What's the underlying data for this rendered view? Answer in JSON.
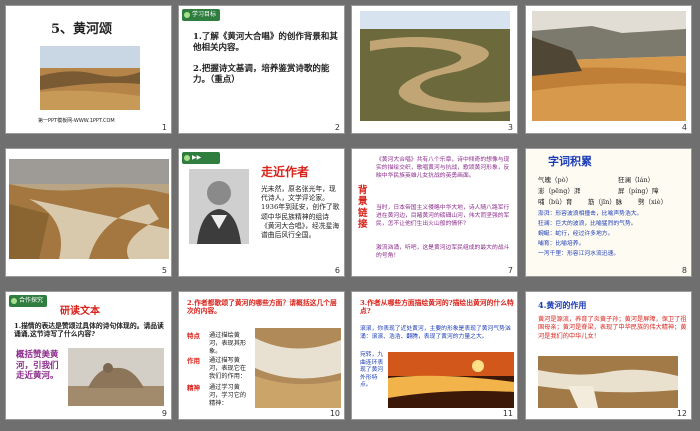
{
  "s1": {
    "title": "5、黄河颂",
    "footer": "第一PPT模板网-WWW.1PPT.COM",
    "num": "1"
  },
  "s2": {
    "tag": "学习目标",
    "goal1": "1.了解《黄河大合唱》的创作背景和其他相关内容。",
    "goal2": "2.把握诗文基调，培养鉴赏诗歌的能力。（重点）",
    "num": "2"
  },
  "s3": {
    "num": "3"
  },
  "s4": {
    "num": "4"
  },
  "s5": {
    "num": "5"
  },
  "s6": {
    "tag": "走近作者",
    "heading": "走近作者",
    "bio": "光未然，原名张光年，现代诗人，文学评论家。1936年到延安，创作了歌颂中华民族精神的组诗《黄河大合唱》，经冼星海谱曲后风行全国。",
    "num": "6"
  },
  "s7": {
    "side": "背景链接",
    "p1": "《黄河大合唱》共有八个乐章，诗中倾奇的想像与现实的描绘交织，歌唱黄河与抗战，歌颂黄河形象，反映中华民族英雄儿女抗战的英勇画面。",
    "p2": "当时，日本帝国主义侵略中华大地，诗人随八路军行进在黄河边，目睹黄河的磅礴山河，伟大而坚强的军民，怎不让他们生出火山般的情怀？",
    "p3": "激流汹涌，听吧，这是黄河边军民组成的最大的战斗的号角！",
    "num": "7"
  },
  "s8": {
    "heading": "字词积累",
    "w1": "气魄（pò）",
    "w2": "狂澜（lán）",
    "w3": "澎（pēng）湃",
    "w4": "屏（píng）障",
    "w5": "哺（bǔ）育",
    "w6": "筋（jīn）脉",
    "w7": "劈（xiè）",
    "d1": "澎湃：形容波浪相撞击，比喻声势浩大。",
    "d2": "狂澜：巨大的波浪，比喻猛烈的气势。",
    "d3": "蜿蜒：蛇行，经过许多地方。",
    "d4": "哺育：比喻培养。",
    "d5": "一泻千里：形容江河水流迅速。",
    "num": "8"
  },
  "s9": {
    "tag": "合作探究",
    "heading": "研读文本",
    "q": "1.描情的表达是赞颂过具体的诗句体现的。请品读诵诵,这节诗写了什么内容?",
    "a": "概括赞美黄河，引我们走近黄河。",
    "num": "9"
  },
  "s10": {
    "q": "2.作者都歌颂了黄河的哪些方面？请概括这几个层次的内容。",
    "rows": [
      {
        "k": "特点",
        "v": "通过描绘黄河，表现其形象。"
      },
      {
        "k": "作用",
        "v": "通过描写黄河，表现它在我们的作用："
      },
      {
        "k": "精神",
        "v": "通过学习黄河，学习它的精神："
      }
    ],
    "num": "10"
  },
  "s11": {
    "q": "3.作者从哪些方面描绘黄河的?描绘出黄河的什么特点?",
    "p": "滚滚，你表现了近处黄河，主要的形象是表现了黄河气势汹涌：滚滚、浩浩、翻腾，表现了黄河的力量之大。",
    "side": "宛转，九曲连环表现了黄河外形特点。",
    "num": "11"
  },
  "s12": {
    "q": "4.黄河的作用",
    "p": "黄河是源流，养育了炎黄子孙；黄河是屏障，保卫了祖国母亲；黄河是脊梁，表现了中华民族的伟大精神；黄河是我们的中华儿女！",
    "num": "12"
  }
}
